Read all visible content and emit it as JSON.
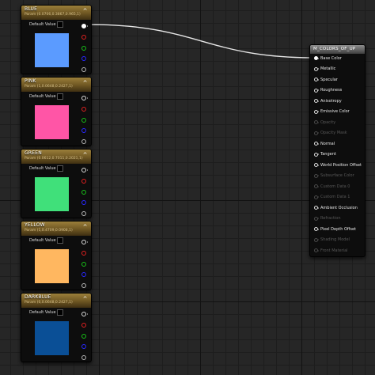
{
  "colors": {
    "header_gradient": [
      "#9b7f3a",
      "#6e5622"
    ],
    "pin_red": "#e02020",
    "pin_green": "#18c018",
    "pin_blue": "#2828ff",
    "wire": "#e6e6e6"
  },
  "param_nodes": [
    {
      "title": "BLUE",
      "subtitle": "Param (0.0706,0.3867,0.965,1)",
      "default_label": "Default Value",
      "swatch_color": "#5b9bff",
      "output_connected": true
    },
    {
      "title": "PINK",
      "subtitle": "Param (1,0.0648,0.2427,1)",
      "default_label": "Default Value",
      "swatch_color": "#ff55a6",
      "output_connected": false
    },
    {
      "title": "GREEN",
      "subtitle": "Param (0.0612,0.7011,0.2021,1)",
      "default_label": "Default Value",
      "swatch_color": "#40e07a",
      "output_connected": false
    },
    {
      "title": "YELLOW",
      "subtitle": "Param (1,0.4709,0.0908,1)",
      "default_label": "Default Value",
      "swatch_color": "#ffb760",
      "output_connected": false
    },
    {
      "title": "DARKBLUE",
      "subtitle": "Param (0,0.0648,0.2427,1)",
      "default_label": "Default Value",
      "swatch_color": "#0a4f96",
      "output_connected": false
    }
  ],
  "material_node": {
    "title": "M_COLORS_OF_UP",
    "inputs": [
      {
        "label": "Base Color",
        "enabled": true,
        "connected": true
      },
      {
        "label": "Metallic",
        "enabled": true,
        "connected": false
      },
      {
        "label": "Specular",
        "enabled": true,
        "connected": false
      },
      {
        "label": "Roughness",
        "enabled": true,
        "connected": false
      },
      {
        "label": "Anisotropy",
        "enabled": true,
        "connected": false
      },
      {
        "label": "Emissive Color",
        "enabled": true,
        "connected": false
      },
      {
        "label": "Opacity",
        "enabled": false,
        "connected": false
      },
      {
        "label": "Opacity Mask",
        "enabled": false,
        "connected": false
      },
      {
        "label": "Normal",
        "enabled": true,
        "connected": false
      },
      {
        "label": "Tangent",
        "enabled": true,
        "connected": false
      },
      {
        "label": "World Position Offset",
        "enabled": true,
        "connected": false
      },
      {
        "label": "Subsurface Color",
        "enabled": false,
        "connected": false
      },
      {
        "label": "Custom Data 0",
        "enabled": false,
        "connected": false
      },
      {
        "label": "Custom Data 1",
        "enabled": false,
        "connected": false
      },
      {
        "label": "Ambient Occlusion",
        "enabled": true,
        "connected": false
      },
      {
        "label": "Refraction",
        "enabled": false,
        "connected": false
      },
      {
        "label": "Pixel Depth Offset",
        "enabled": true,
        "connected": false
      },
      {
        "label": "Shading Model",
        "enabled": false,
        "connected": false
      },
      {
        "label": "Front Material",
        "enabled": false,
        "connected": false
      }
    ]
  }
}
